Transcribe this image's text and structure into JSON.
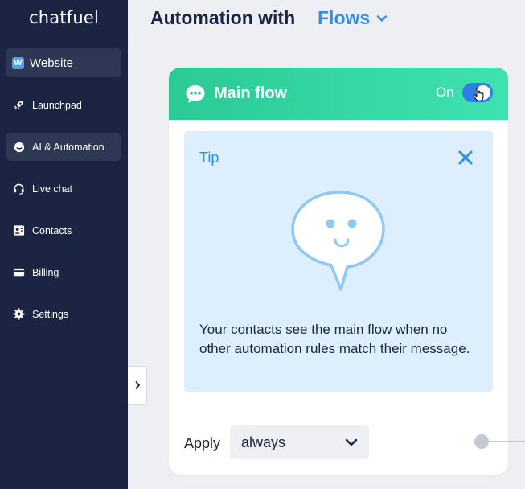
{
  "sidebar": {
    "logo": "chatfuel",
    "workspace": {
      "badge": "W",
      "label": "Website"
    },
    "items": [
      {
        "label": "Launchpad",
        "icon": "rocket-icon"
      },
      {
        "label": "AI & Automation",
        "icon": "bot-icon",
        "active": true
      },
      {
        "label": "Live chat",
        "icon": "headset-icon"
      },
      {
        "label": "Contacts",
        "icon": "contacts-icon"
      },
      {
        "label": "Billing",
        "icon": "card-icon"
      },
      {
        "label": "Settings",
        "icon": "gear-icon"
      }
    ]
  },
  "header": {
    "title": "Automation with",
    "dropdown_value": "Flows"
  },
  "card": {
    "title": "Main flow",
    "toggle_label": "On",
    "toggle_on": true,
    "tip": {
      "label": "Tip",
      "text": "Your contacts see the main flow when no other automation rules match their message."
    },
    "apply": {
      "label": "Apply",
      "value": "always"
    }
  },
  "colors": {
    "sidebar_bg": "#1b2543",
    "accent_blue": "#2f8ee6",
    "header_green": "#2bca95",
    "tip_bg": "#ddeefd"
  }
}
